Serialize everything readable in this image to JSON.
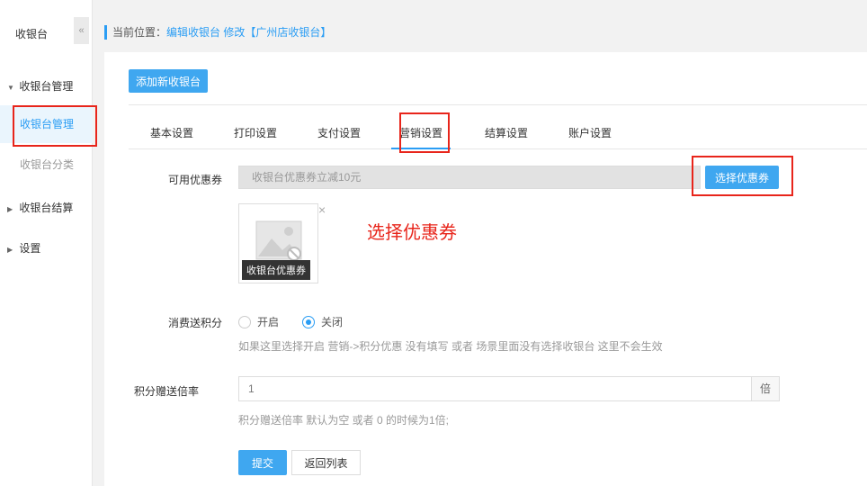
{
  "sidebar": {
    "title": "收银台",
    "collapse_icon": "«",
    "groups": [
      {
        "label": "收银台管理",
        "arrow": "▼"
      },
      {
        "label": "收银台结算",
        "arrow": "▶"
      },
      {
        "label": "设置",
        "arrow": "▶"
      }
    ],
    "subitems": [
      {
        "label": "收银台管理",
        "active": true
      },
      {
        "label": "收银台分类",
        "active": false
      }
    ]
  },
  "breadcrumb": {
    "prefix": "当前位置：",
    "link": "编辑收银台 修改【广州店收银台】"
  },
  "toolbar": {
    "add_label": "添加新收银台"
  },
  "tabs": [
    {
      "label": "基本设置"
    },
    {
      "label": "打印设置"
    },
    {
      "label": "支付设置"
    },
    {
      "label": "营销设置",
      "active": true
    },
    {
      "label": "结算设置"
    },
    {
      "label": "账户设置"
    }
  ],
  "form": {
    "coupon_label": "可用优惠券",
    "coupon_value": "收银台优惠券立减10元",
    "coupon_button": "选择优惠券",
    "coupon_card_label": "收银台优惠券",
    "remove_icon": "×",
    "points_label": "消费送积分",
    "radio_on": "开启",
    "radio_off": "关闭",
    "points_selected": "关闭",
    "points_help": "如果这里选择开启 营销->积分优惠 没有填写 或者 场景里面没有选择收银台 这里不会生效",
    "rate_label": "积分赠送倍率",
    "rate_value": "1",
    "rate_unit": "倍",
    "rate_help": "积分赠送倍率 默认为空 或者 0 的时候为1倍;",
    "submit_label": "提交",
    "back_label": "返回列表"
  },
  "annotation": {
    "text": "选择优惠券",
    "color": "#e8251b"
  },
  "colors": {
    "accent": "#2a9df4",
    "button": "#3fa7f0",
    "annotation": "#e8251b"
  }
}
